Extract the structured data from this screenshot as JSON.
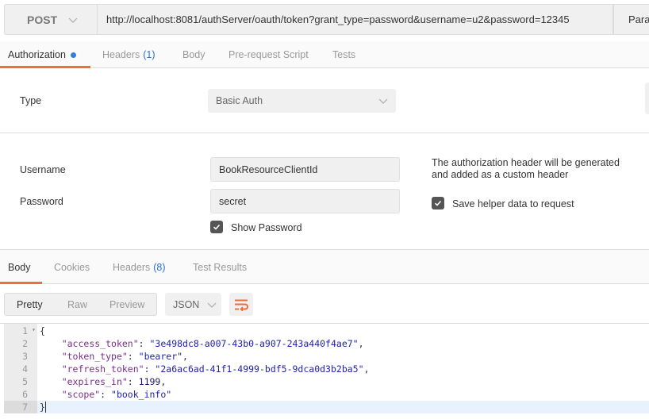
{
  "request": {
    "method": "POST",
    "url": "http://localhost:8081/authServer/oauth/token?grant_type=password&username=u2&password=12345",
    "params_label": "Params"
  },
  "request_tabs": [
    {
      "label": "Authorization",
      "active": true,
      "dot": true
    },
    {
      "label": "Headers",
      "count": "(1)"
    },
    {
      "label": "Body"
    },
    {
      "label": "Pre-request Script"
    },
    {
      "label": "Tests"
    }
  ],
  "auth": {
    "type_label": "Type",
    "type_value": "Basic Auth",
    "username_label": "Username",
    "username_value": "BookResourceClientId",
    "password_label": "Password",
    "password_value": "secret",
    "show_password_label": "Show Password",
    "show_password_checked": true,
    "note": "The authorization header will be generated and added as a custom header",
    "save_helper_label": "Save helper data to request",
    "save_helper_checked": true
  },
  "response_tabs": [
    {
      "label": "Body",
      "active": true
    },
    {
      "label": "Cookies"
    },
    {
      "label": "Headers",
      "count": "(8)"
    },
    {
      "label": "Test Results"
    }
  ],
  "response_toolbar": {
    "view_modes": [
      "Pretty",
      "Raw",
      "Preview"
    ],
    "active_view": "Pretty",
    "format": "JSON",
    "wrap_icon": "wrap-lines-icon"
  },
  "accent_color": "#f26b3a",
  "response_body": {
    "lines": [
      {
        "n": "1",
        "text": "{"
      },
      {
        "n": "2",
        "key": "\"access_token\"",
        "value": "\"3e498dc8-a007-43b0-a907-243a440f4ae7\"",
        "trail": ","
      },
      {
        "n": "3",
        "key": "\"token_type\"",
        "value": "\"bearer\"",
        "trail": ","
      },
      {
        "n": "4",
        "key": "\"refresh_token\"",
        "value": "\"2a6ac6ad-41f1-4999-bdf5-9dca0d3b2ba5\"",
        "trail": ","
      },
      {
        "n": "5",
        "key": "\"expires_in\"",
        "value": "1199",
        "trail": ","
      },
      {
        "n": "6",
        "key": "\"scope\"",
        "value": "\"book_info\"",
        "trail": ""
      },
      {
        "n": "7",
        "text": "}"
      }
    ]
  }
}
